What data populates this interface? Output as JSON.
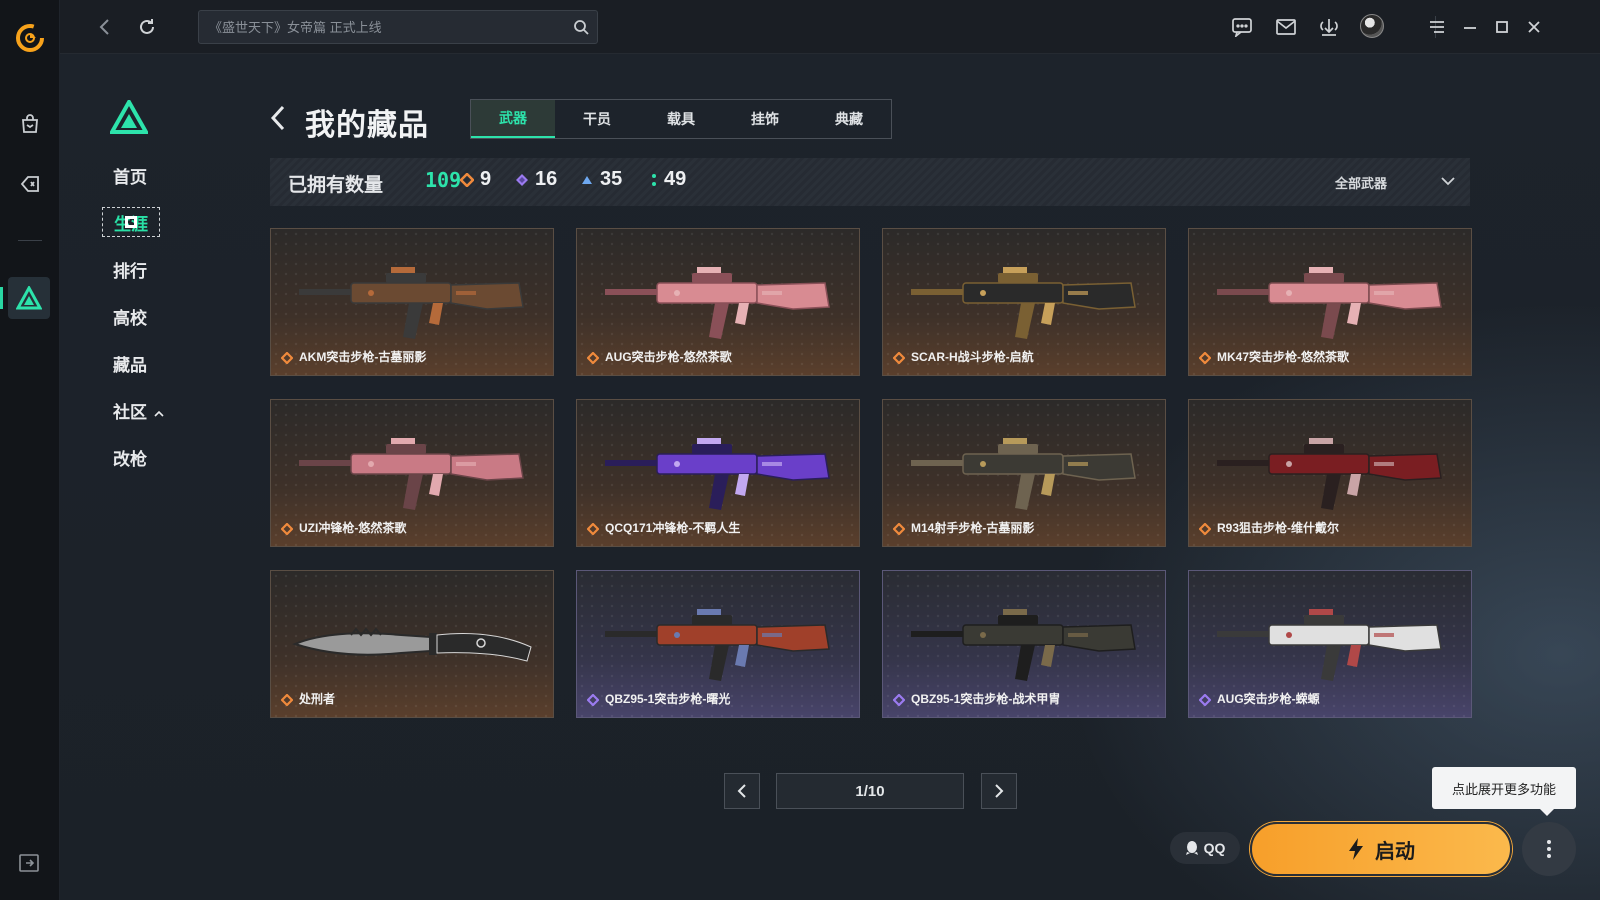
{
  "topbar": {
    "search_placeholder": "《盛世天下》女帝篇 正式上线"
  },
  "subnav": {
    "items": [
      {
        "label": "首页"
      },
      {
        "label": "生涯"
      },
      {
        "label": "排行"
      },
      {
        "label": "高校"
      },
      {
        "label": "藏品"
      },
      {
        "label": "社区"
      },
      {
        "label": "改枪"
      }
    ],
    "active_index": 1
  },
  "header": {
    "title": "我的藏品",
    "tabs": [
      {
        "label": "武器"
      },
      {
        "label": "干员"
      },
      {
        "label": "载具"
      },
      {
        "label": "挂饰"
      },
      {
        "label": "典藏"
      }
    ],
    "active_tab": 0
  },
  "stats": {
    "owned_label": "已拥有数量",
    "owned_total": "109",
    "rarity_counts": [
      {
        "icon": "orange-diamond-icon",
        "color": "#f08a3c",
        "count": "9"
      },
      {
        "icon": "purple-diamond-icon",
        "color": "#9b7bf0",
        "count": "16"
      },
      {
        "icon": "blue-diamond-icon",
        "color": "#6ea8f0",
        "count": "35"
      },
      {
        "icon": "green-dots-icon",
        "color": "#2de3ab",
        "count": "49"
      }
    ],
    "filter_label": "全部武器"
  },
  "items": [
    {
      "name": "AKM突击步枪-古墓丽影",
      "rarity": "orange",
      "palette": [
        "#6b4a32",
        "#3a3a3a",
        "#b56a3a"
      ]
    },
    {
      "name": "AUG突击步枪-悠然茶歌",
      "rarity": "orange",
      "palette": [
        "#d88b92",
        "#8a5058",
        "#e6b1b4"
      ]
    },
    {
      "name": "SCAR-H战斗步枪-启航",
      "rarity": "orange",
      "palette": [
        "#2a2a2a",
        "#7a6033",
        "#c7a05a"
      ]
    },
    {
      "name": "MK47突击步枪-悠然茶歌",
      "rarity": "orange",
      "palette": [
        "#d88b92",
        "#7a4a4e",
        "#e6b1b4"
      ]
    },
    {
      "name": "UZI冲锋枪-悠然茶歌",
      "rarity": "orange",
      "palette": [
        "#c97a85",
        "#6a4448",
        "#e2a9ae"
      ]
    },
    {
      "name": "QCQ171冲锋枪-不羁人生",
      "rarity": "orange",
      "palette": [
        "#6a3fc9",
        "#2a1e5a",
        "#c2a8f0"
      ]
    },
    {
      "name": "M14射手步枪-古墓丽影",
      "rarity": "orange",
      "palette": [
        "#3c3a34",
        "#6e6350",
        "#b79a5a"
      ]
    },
    {
      "name": "R93狙击步枪-维什戴尔",
      "rarity": "orange",
      "palette": [
        "#7a1e22",
        "#2a2020",
        "#c9a4a6"
      ]
    },
    {
      "name": "处刑者",
      "rarity": "orange",
      "palette": [
        "#9a9a9a",
        "#2a2a2a",
        "#d8d8d8"
      ]
    },
    {
      "name": "QBZ95-1突击步枪-曙光",
      "rarity": "purple",
      "palette": [
        "#a0402a",
        "#2a2a2a",
        "#6a7ab0"
      ]
    },
    {
      "name": "QBZ95-1突击步枪-战术甲胄",
      "rarity": "purple",
      "palette": [
        "#3a3a34",
        "#1e1e1e",
        "#7a6a4a"
      ]
    },
    {
      "name": "AUG突击步枪-蝾螈",
      "rarity": "purple",
      "palette": [
        "#e0e0e0",
        "#3a3a3a",
        "#b04848"
      ]
    }
  ],
  "pagination": {
    "current": "1/10"
  },
  "tooltip": "点此展开更多功能",
  "qq_label": "QQ",
  "launch_label": "启动",
  "colors": {
    "accent": "#2de3ab",
    "launch": "#f9a93a",
    "orange_rarity": "#f08a3c",
    "purple_rarity": "#9b7bf0"
  }
}
